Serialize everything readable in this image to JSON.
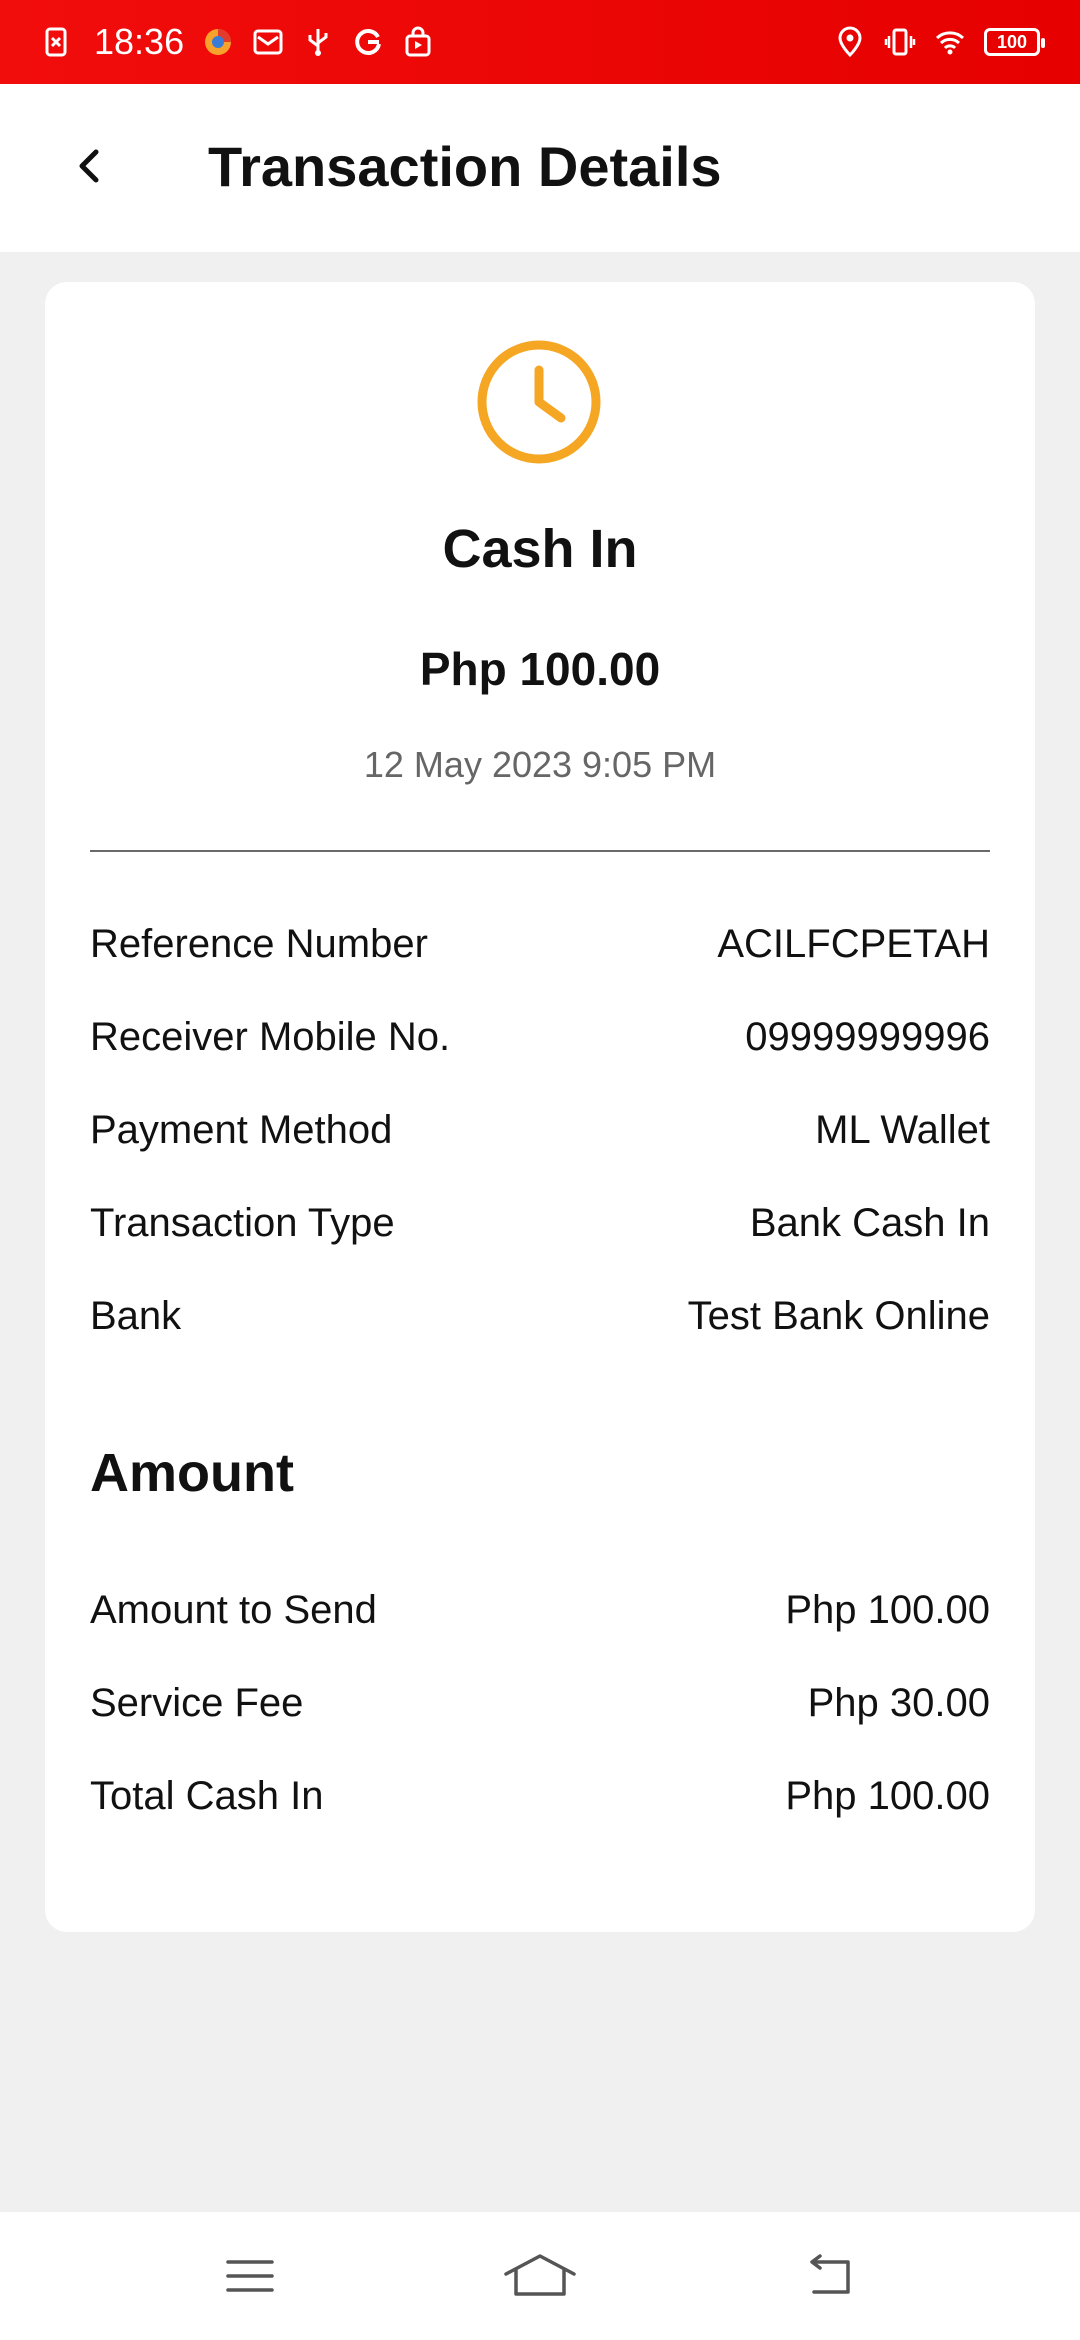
{
  "status_bar": {
    "time": "18:36",
    "battery": "100",
    "left_icons": [
      "sim-off-icon",
      "browser-icon",
      "mail-icon",
      "usb-icon",
      "google-icon",
      "store-icon"
    ],
    "right_icons": [
      "location-icon",
      "vibrate-icon",
      "wifi-icon",
      "battery-icon"
    ]
  },
  "header": {
    "title": "Transaction Details"
  },
  "transaction": {
    "status_icon": "clock-icon",
    "status_color": "#f5a623",
    "title": "Cash In",
    "amount": "Php 100.00",
    "date": "12 May 2023 9:05 PM"
  },
  "details": [
    {
      "label": "Reference Number",
      "value": "ACILFCPETAH"
    },
    {
      "label": "Receiver Mobile No.",
      "value": "09999999996"
    },
    {
      "label": "Payment Method",
      "value": "ML Wallet"
    },
    {
      "label": "Transaction Type",
      "value": "Bank Cash In"
    },
    {
      "label": "Bank",
      "value": "Test Bank Online"
    }
  ],
  "amount_section": {
    "title": "Amount",
    "rows": [
      {
        "label": "Amount to Send",
        "value": "Php 100.00"
      },
      {
        "label": "Service Fee",
        "value": "Php 30.00"
      },
      {
        "label": "Total Cash In",
        "value": "Php 100.00"
      }
    ]
  },
  "nav": {
    "icons": [
      "menu-icon",
      "home-icon",
      "back-nav-icon"
    ]
  },
  "colors": {
    "status_bar": "#e60000",
    "accent": "#f5a623",
    "background": "#f0f0f0"
  }
}
